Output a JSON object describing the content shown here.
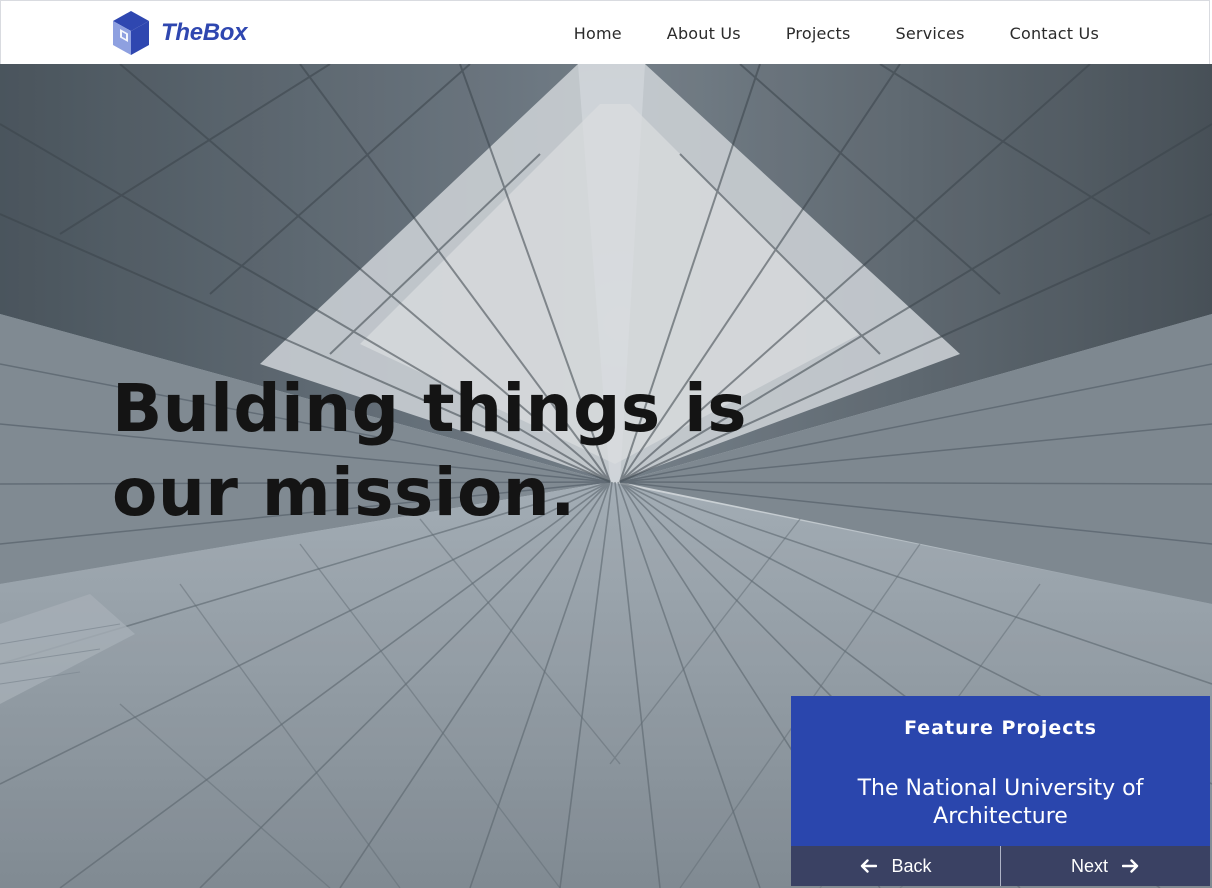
{
  "brand": {
    "name": "TheBox",
    "logo_icon": "cube-logo-icon",
    "colors": {
      "primary": "#2a46ad",
      "cube_dark": "#2f47b0",
      "cube_light": "#8ea0e0"
    }
  },
  "nav": {
    "items": [
      {
        "label": "Home"
      },
      {
        "label": "About Us"
      },
      {
        "label": "Projects"
      },
      {
        "label": "Services"
      },
      {
        "label": "Contact Us"
      }
    ]
  },
  "hero": {
    "headline_line1": "Bulding things is",
    "headline_line2": "our mission."
  },
  "feature": {
    "label": "Feature Projects",
    "title": "The National University of Architecture",
    "back_label": "Back",
    "next_label": "Next",
    "back_icon": "arrow-left-icon",
    "next_icon": "arrow-right-icon",
    "nav_color": "#3a4163"
  }
}
